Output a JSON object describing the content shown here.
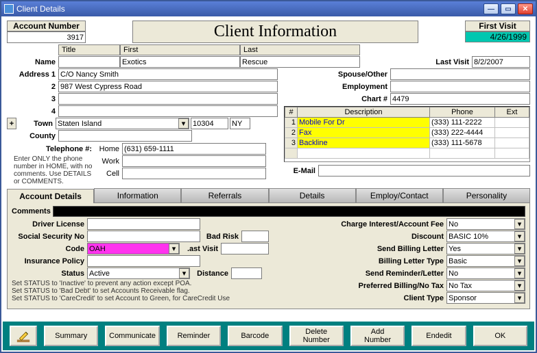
{
  "window": {
    "title": "Client Details"
  },
  "header": {
    "account_number_label": "Account Number",
    "account_number": "3917",
    "heading": "Client Information",
    "first_visit_label": "First Visit",
    "first_visit": "4/26/1999"
  },
  "namecols": {
    "title": "Title",
    "first": "First",
    "last": "Last"
  },
  "labels": {
    "name": "Name",
    "address1": "Address 1",
    "r2": "2",
    "r3": "3",
    "r4": "4",
    "town": "Town",
    "county": "County",
    "telephone": "Telephone #:",
    "home": "Home",
    "work": "Work",
    "cell": "Cell",
    "last_visit": "Last Visit",
    "spouse": "Spouse/Other",
    "employment": "Employment",
    "chartno": "Chart #",
    "email": "E-Mail",
    "tel_hint": "Enter ONLY the phone number in HOME, with no comments. Use DETAILS or COMMENTS."
  },
  "name": {
    "title": "",
    "first": "Exotics",
    "last": "Rescue"
  },
  "lastvisit": "8/2/2007",
  "spouse": "",
  "employment": "",
  "chartno": "4479",
  "address": {
    "a1": "C/O Nancy Smith",
    "a2": "987 West Cypress Road",
    "a3": "",
    "a4": ""
  },
  "town": "Staten Island",
  "zip": "10304",
  "state": "NY",
  "county": "",
  "phones": {
    "home": "(631) 659-1111",
    "work": "",
    "cell": ""
  },
  "email": "",
  "phonegrid": {
    "hnum": "#",
    "hdesc": "Description",
    "hphone": "Phone",
    "hext": "Ext",
    "rows": [
      {
        "n": "1",
        "desc": "Mobile For Dr",
        "phone": "(333) 111-2222",
        "ext": ""
      },
      {
        "n": "2",
        "desc": "Fax",
        "phone": "(333) 222-4444",
        "ext": ""
      },
      {
        "n": "3",
        "desc": "Backline",
        "phone": "(333) 111-5678",
        "ext": ""
      }
    ]
  },
  "tabs": {
    "t0": "Account Details",
    "t1": "Information",
    "t2": "Referrals",
    "t3": "Details",
    "t4": "Employ/Contact",
    "t5": "Personality"
  },
  "account": {
    "comments_lbl": "Comments",
    "dl_lbl": "Driver License",
    "dl": "",
    "ssn_lbl": "Social Security No",
    "ssn": "",
    "badrisk_lbl": "Bad Risk",
    "badrisk": "",
    "code_lbl": "Code",
    "code": "OAH",
    "lastvisit_lbl": ".ast Visit",
    "lastvisit": "",
    "ins_lbl": "Insurance Policy",
    "ins": "",
    "status_lbl": "Status",
    "status": "Active",
    "distance_lbl": "Distance",
    "distance": "",
    "hint0": "Set STATUS to 'Inactive' to prevent any action except POA.",
    "hint1": "Set STATUS to 'Bad Debt'  to set Accounts Receivable flag.",
    "hint2": "Set STATUS to 'CareCredit' to set Account to Green, for CareCredit Use",
    "r_charge_lbl": "Charge Interest/Account Fee",
    "r_charge": "No",
    "r_disc_lbl": "Discount",
    "r_disc": "BASIC 10%",
    "r_sbl_lbl": "Send Billing Letter",
    "r_sbl": "Yes",
    "r_blt_lbl": "Billing Letter Type",
    "r_blt": "Basic",
    "r_srl_lbl": "Send Reminder/Letter",
    "r_srl": "No",
    "r_pbnt_lbl": "Preferred Billing/No Tax",
    "r_pbnt": "No Tax",
    "r_ct_lbl": "Client Type",
    "r_ct": "Sponsor"
  },
  "buttons": {
    "summary": "Summary",
    "communicate": "Communicate",
    "reminder": "Reminder",
    "barcode": "Barcode",
    "delete": "Delete\nNumber",
    "add": "Add\nNumber",
    "endedit": "Endedit",
    "ok": "OK"
  }
}
